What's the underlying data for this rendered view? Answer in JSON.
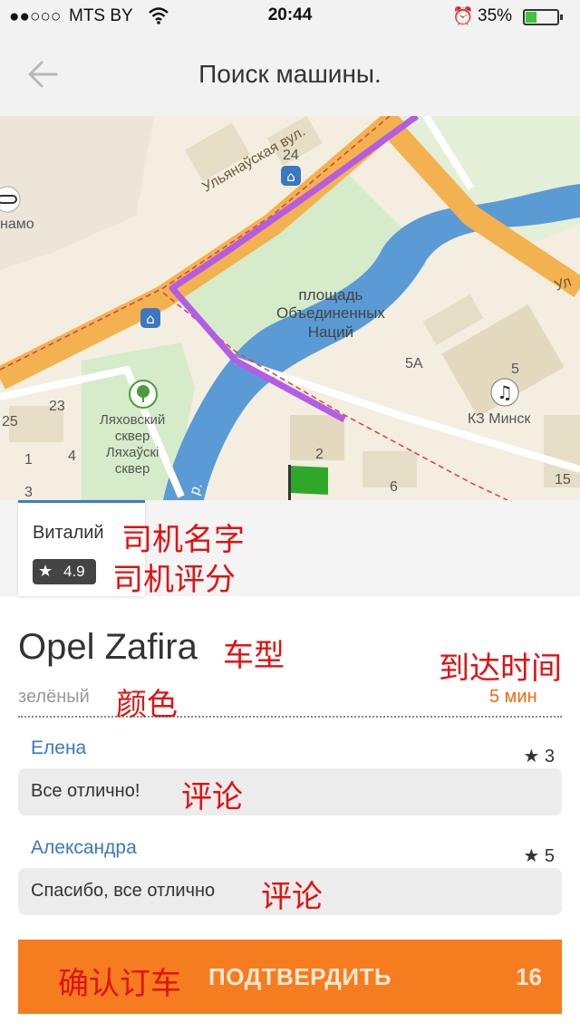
{
  "status_bar": {
    "carrier": "MTS BY",
    "time": "20:44",
    "battery_percent": "35%",
    "battery_level": 0.35,
    "icons": [
      "signal-dots-icon",
      "wifi-icon",
      "alarm-icon",
      "battery-icon"
    ]
  },
  "nav": {
    "title": "Поиск машины.",
    "back_icon": "back-arrow-icon"
  },
  "map": {
    "labels": {
      "dinamo": "намо",
      "num_24": "24",
      "street_1": "Ульянаўская вул.",
      "street_2": "Ул",
      "square": "площадь\nОбъединенных\nНаций",
      "num_5a": "5А",
      "num_5": "5",
      "kz_minsk": "КЗ Минск",
      "park": "Ляховский\nсквер\nЛяхаўскі\nсквер",
      "num_23": "23",
      "num_25": "25",
      "num_4": "4",
      "num_1": "1",
      "num_3": "3",
      "num_2": "2",
      "num_6": "6",
      "num_15": "15",
      "river_p": "р."
    },
    "colors": {
      "road": "#f3b24f",
      "route": "#b45ce6",
      "water": "#5b9bd5",
      "park": "#d5ebc9",
      "flag": "#2fa82a"
    }
  },
  "driver": {
    "name": "Виталий",
    "rating": "4.9"
  },
  "car": {
    "model": "Opel Zafira",
    "color": "зелёный",
    "eta": "5 мин"
  },
  "reviews": [
    {
      "author": "Елена",
      "rating": "3",
      "text": "Все отлично!"
    },
    {
      "author": "Александра",
      "rating": "5",
      "text": "Спасибо, все отлично"
    }
  ],
  "confirm": {
    "label": "ПОДТВЕРДИТЬ",
    "count": "16"
  },
  "annotations": {
    "driver_name": "司机名字",
    "driver_rating": "司机评分",
    "car_model": "车型",
    "arrival_time": "到达时间",
    "color": "颜色",
    "comment_1": "评论",
    "comment_2": "评论",
    "confirm": "确认订车"
  },
  "accent_colors": {
    "orange": "#f57c1f",
    "blue": "#3a78c0",
    "annotation_red": "#e01212"
  }
}
